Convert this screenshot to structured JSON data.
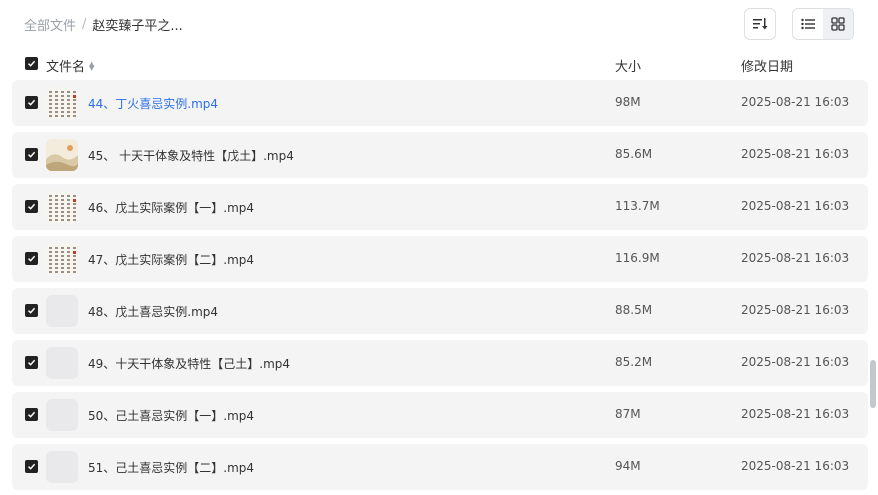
{
  "breadcrumb": {
    "root": "全部文件",
    "separator": "/",
    "current": "赵奕臻子平之..."
  },
  "toolbar": {
    "sort_icon": "sort-icon",
    "list_icon": "list-view-icon",
    "grid_icon": "grid-view-icon"
  },
  "columns": {
    "name": "文件名",
    "size": "大小",
    "modified": "修改日期"
  },
  "files": [
    {
      "name": "44、丁火喜忌实例.mp4",
      "size": "98M",
      "date": "2025-08-21 16:03",
      "thumb": "table"
    },
    {
      "name": "45、 十天干体象及特性【戊土】.mp4",
      "size": "85.6M",
      "date": "2025-08-21 16:03",
      "thumb": "landscape"
    },
    {
      "name": "46、戊土实际案例【一】.mp4",
      "size": "113.7M",
      "date": "2025-08-21 16:03",
      "thumb": "table"
    },
    {
      "name": "47、戊土实际案例【二】.mp4",
      "size": "116.9M",
      "date": "2025-08-21 16:03",
      "thumb": "table"
    },
    {
      "name": "48、戊土喜忌实例.mp4",
      "size": "88.5M",
      "date": "2025-08-21 16:03",
      "thumb": "blank"
    },
    {
      "name": "49、十天干体象及特性【己土】.mp4",
      "size": "85.2M",
      "date": "2025-08-21 16:03",
      "thumb": "blank"
    },
    {
      "name": "50、己土喜忌实例【一】.mp4",
      "size": "87M",
      "date": "2025-08-21 16:03",
      "thumb": "blank"
    },
    {
      "name": "51、己土喜忌实例【二】.mp4",
      "size": "94M",
      "date": "2025-08-21 16:03",
      "thumb": "blank"
    }
  ],
  "colors": {
    "link": "#2d6fe8",
    "row_bg": "#f4f4f5",
    "checkbox": "#222222"
  }
}
